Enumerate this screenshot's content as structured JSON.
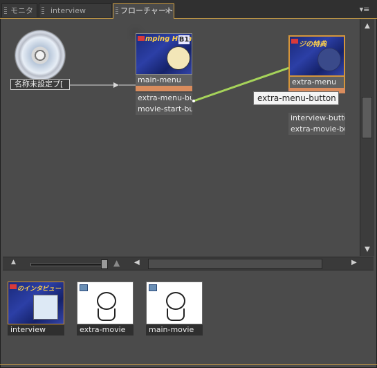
{
  "tabs": [
    {
      "label": "モニタ",
      "active": false
    },
    {
      "label": "interview",
      "active": false
    },
    {
      "label": "フローチャート",
      "active": true,
      "close": "×"
    }
  ],
  "panel_menu_icon": "panel-menu-icon",
  "flowchart": {
    "disc": {
      "label": "名称未設定プ[",
      "icon": "dvd-disc-icon"
    },
    "menus": [
      {
        "id": "main-menu",
        "title": "main-menu",
        "thumb_text": "mping Hoshi",
        "badge": "B1",
        "buttons": [
          "extra-menu-but",
          "movie-start-bu"
        ]
      },
      {
        "id": "extra-menu",
        "title": "extra-menu",
        "thumb_text": "ジの特典",
        "buttons": [
          "interview-butto",
          "extra-movie-bu"
        ]
      }
    ],
    "tooltip": "extra-menu-button",
    "link_color": "#a6d35a"
  },
  "assets": [
    {
      "label": "interview",
      "thumb_text": "のインタビュー"
    },
    {
      "label": "extra-movie"
    },
    {
      "label": "main-movie"
    }
  ],
  "colors": {
    "accent": "#d6a545",
    "selected_border": "#d6963a",
    "node_bar": "#d98c5d"
  }
}
